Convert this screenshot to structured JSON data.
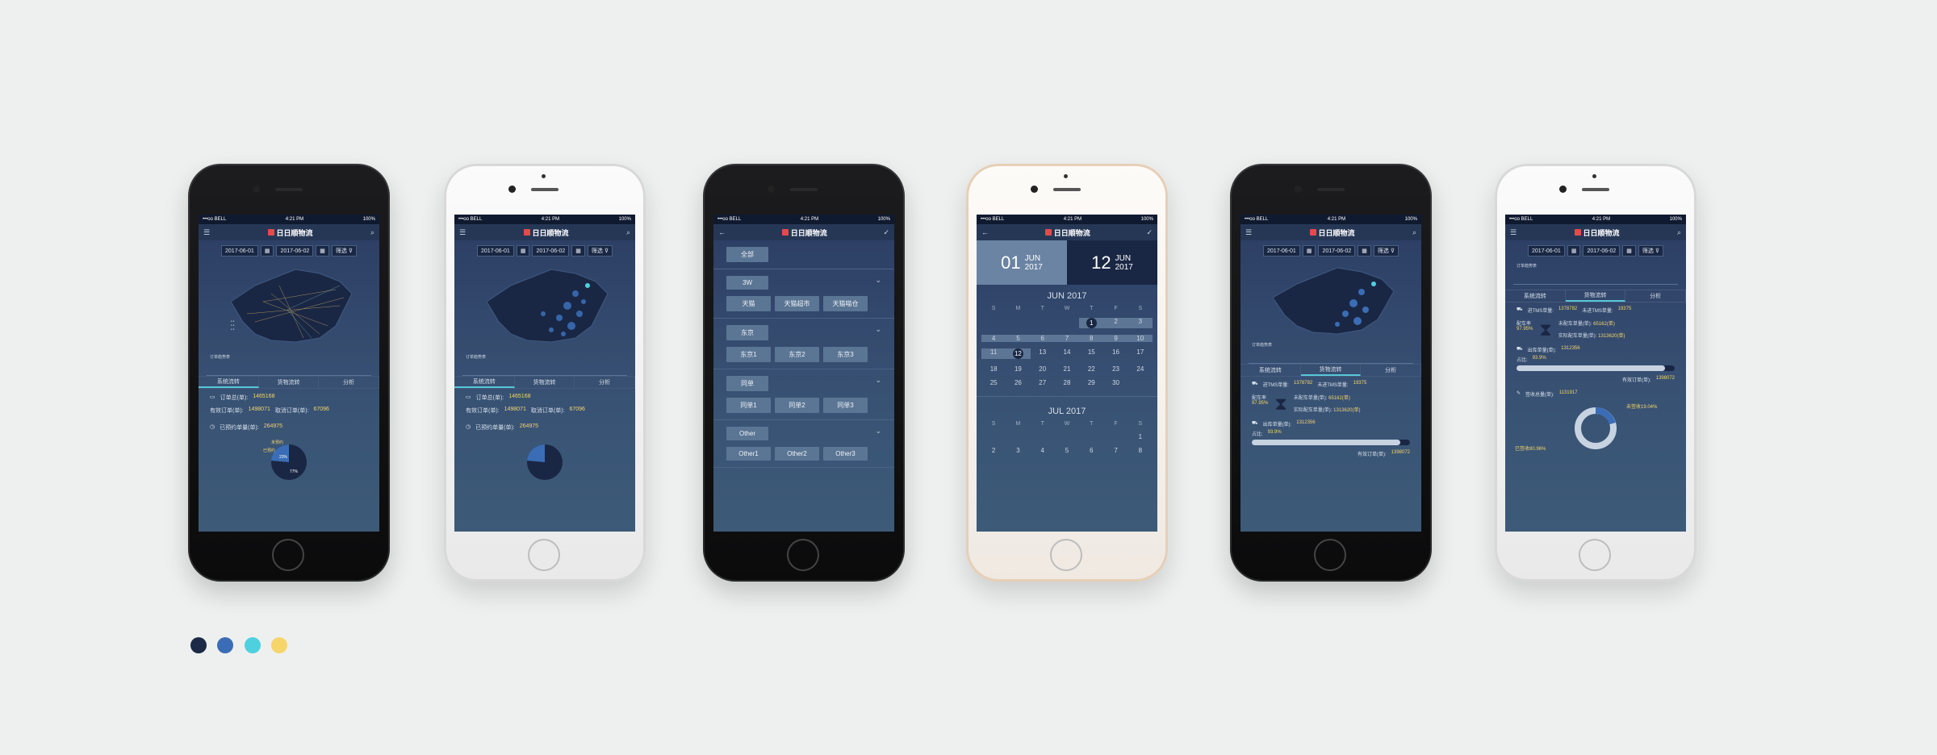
{
  "status": {
    "carrier": "•••oo BELL",
    "time": "4:21 PM",
    "battery": "100%"
  },
  "app_title": "日日顺物流",
  "filter_date_start": "2017-06-01",
  "filter_date_end": "2017-06-02",
  "filter_btn": "筛选",
  "chart_label": "订单趋势表",
  "tabs": [
    "系统流转",
    "货物流转",
    "分析"
  ],
  "screen1": {
    "order_total_label": "订单总(单):",
    "order_total": "1465168",
    "valid_label": "有效订单(单):",
    "valid": "1498071",
    "cancel_label": "取消订单(单):",
    "cancel": "67096",
    "signed_label": "已预约单量(单):",
    "signed": "264975",
    "pie_a_label": "未预约",
    "pie_b_label": "已预约",
    "pie_a_pct": "23%",
    "pie_b_pct": "77%"
  },
  "filters": {
    "all": "全部",
    "groups": [
      {
        "name": "3W",
        "items": [
          "天猫",
          "天猫超市",
          "天猫喵仓"
        ]
      },
      {
        "name": "东京",
        "items": [
          "东京1",
          "东京2",
          "东京3"
        ]
      },
      {
        "name": "同单",
        "items": [
          "同单1",
          "同单2",
          "同单3"
        ]
      },
      {
        "name": "Other",
        "items": [
          "Other1",
          "Other2",
          "Other3"
        ]
      }
    ]
  },
  "calendar": {
    "start_day": "01",
    "start_month": "JUN",
    "start_year": "2017",
    "end_day": "12",
    "end_month": "JUN",
    "end_year": "2017",
    "month1": "JUN 2017",
    "month2": "JUL 2017",
    "weekdays": [
      "S",
      "M",
      "T",
      "W",
      "T",
      "F",
      "S"
    ],
    "jun_days": [
      "",
      "",
      "",
      "",
      "1",
      "2",
      "3",
      "4",
      "5",
      "6",
      "7",
      "8",
      "9",
      "10",
      "11",
      "12",
      "13",
      "14",
      "15",
      "16",
      "17",
      "18",
      "19",
      "20",
      "21",
      "22",
      "23",
      "24",
      "25",
      "26",
      "27",
      "28",
      "29",
      "30"
    ],
    "jul_days": [
      "",
      "",
      "",
      "",
      "",
      "",
      "1",
      "2",
      "3",
      "4",
      "5",
      "6",
      "7",
      "8"
    ]
  },
  "screen5": {
    "tms_in_label": "进TMS单量:",
    "tms_in": "1378782",
    "tms_not_label": "未进TMS单量:",
    "tms_not": "19375",
    "rate_label": "配车率",
    "rate": "97.95%",
    "unmatched_label": "未配车单量(单):",
    "unmatched": "65162(单)",
    "matched_label": "实际配车单量(单):",
    "matched": "1313620(单)",
    "out_label": "出库单量(单):",
    "out": "1312356",
    "share_label": "占比:",
    "share": "93.9%",
    "share_fill": 0.939,
    "valid_label": "有效订单(单):",
    "valid": "1398072"
  },
  "screen6": {
    "sign_label": "签收总量(单):",
    "sign": "1131917",
    "unsigned": "未签收19.04%",
    "signed": "已签收80.96%"
  },
  "palette": [
    "#1c2a47",
    "#3a6db5",
    "#4fd0de",
    "#f6d56b"
  ]
}
